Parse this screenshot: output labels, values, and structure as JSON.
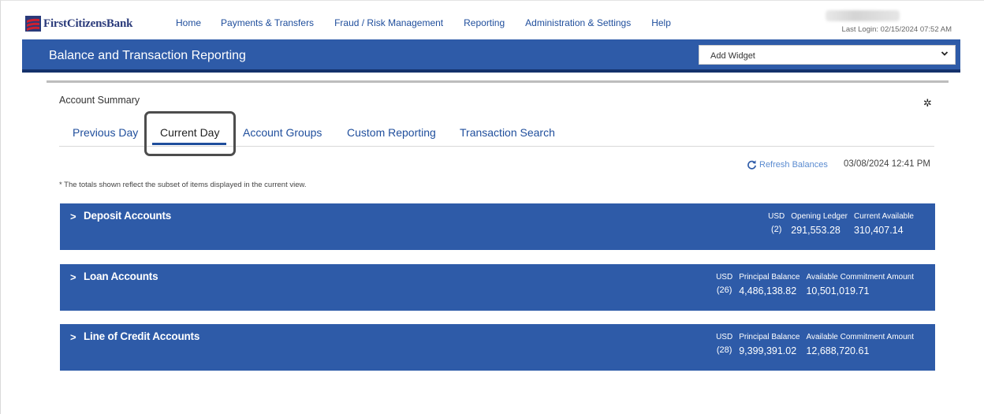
{
  "brand": {
    "name": "FirstCitizensBank"
  },
  "nav": [
    "Home",
    "Payments & Transfers",
    "Fraud / Risk Management",
    "Reporting",
    "Administration & Settings",
    "Help"
  ],
  "user": {
    "last_login": "Last Login: 02/15/2024 07:52 AM"
  },
  "header": {
    "title": "Balance and Transaction Reporting",
    "widget_select": "Add Widget"
  },
  "summary": {
    "title": "Account Summary",
    "tabs": [
      "Previous Day",
      "Current Day",
      "Account Groups",
      "Custom Reporting",
      "Transaction Search"
    ],
    "active_tab": "Current Day",
    "refresh_label": "Refresh Balances",
    "refresh_timestamp": "03/08/2024 12:41 PM",
    "note": "* The totals shown reflect the subset of items displayed in the current view."
  },
  "sections": [
    {
      "name": "Deposit Accounts",
      "currency": "USD",
      "count": "(2)",
      "col1_label": "Opening Ledger",
      "col1_value": "291,553.28",
      "col2_label": "Current Available",
      "col2_value": "310,407.14"
    },
    {
      "name": "Loan Accounts",
      "currency": "USD",
      "count": "(26)",
      "col1_label": "Principal Balance",
      "col1_value": "4,486,138.82",
      "col2_label": "Available Commitment Amount",
      "col2_value": "10,501,019.71"
    },
    {
      "name": "Line of Credit Accounts",
      "currency": "USD",
      "count": "(28)",
      "col1_label": "Principal Balance",
      "col1_value": "9,399,391.02",
      "col2_label": "Available Commitment Amount",
      "col2_value": "12,688,720.61"
    }
  ],
  "colors": {
    "brand_blue": "#2e5ba8",
    "dark_navy": "#14316b",
    "link": "#1f4e9c",
    "logo_red": "#d0202f"
  }
}
